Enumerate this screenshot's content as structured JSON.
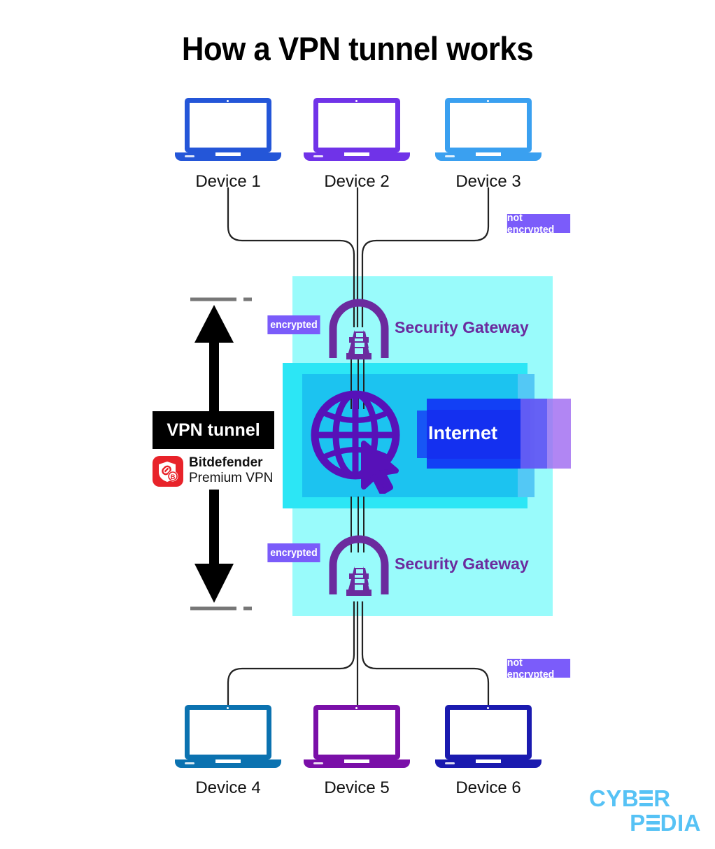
{
  "title": "How a VPN tunnel works",
  "colors": {
    "panel_outer": "#99FBFB",
    "panel_mid": "#2CE6F5",
    "panel_inner": "#1CC3F0",
    "badge_purple": "#7B5CFA",
    "gateway_purple": "#6B2B9E",
    "internet_blue": "#1430F0",
    "internet_violet": "#A06BF0",
    "tunnel_black": "#000000",
    "bitdefender_red": "#E8232A",
    "logo_blue": "#56C2F5",
    "connector_line": "#222222",
    "dash_gray": "#777777"
  },
  "devices_top": [
    {
      "label": "Device 1",
      "color": "#2456D8",
      "icon": "laptop-icon"
    },
    {
      "label": "Device 2",
      "color": "#7033E8",
      "icon": "laptop-icon"
    },
    {
      "label": "Device 3",
      "color": "#3AA0F0",
      "icon": "laptop-icon"
    }
  ],
  "devices_bottom": [
    {
      "label": "Device 4",
      "color": "#0B72B0",
      "icon": "laptop-icon"
    },
    {
      "label": "Device 5",
      "color": "#7A0FA8",
      "icon": "laptop-icon"
    },
    {
      "label": "Device 6",
      "color": "#1A1AAF",
      "icon": "laptop-icon"
    }
  ],
  "badges": {
    "not_encrypted_top": "not encrypted",
    "not_encrypted_bottom": "not encrypted",
    "encrypted_top": "encrypted",
    "encrypted_bottom": "encrypted"
  },
  "gateways": {
    "top_label": "Security Gateway",
    "bottom_label": "Security Gateway",
    "icon": "tunnel-gateway-icon"
  },
  "internet": {
    "label": "Internet",
    "icon": "globe-cursor-icon"
  },
  "tunnel": {
    "label": "VPN tunnel",
    "arrow_up": "arrow-up-icon",
    "arrow_down": "arrow-down-icon"
  },
  "bitdefender": {
    "brand": "Bitdefender",
    "product": "Premium VPN",
    "icon": "bitdefender-shield-icon"
  },
  "logo": {
    "line1_a": "CYB",
    "line1_b": "R",
    "line2_a": "P",
    "line2_b": "DIA"
  }
}
